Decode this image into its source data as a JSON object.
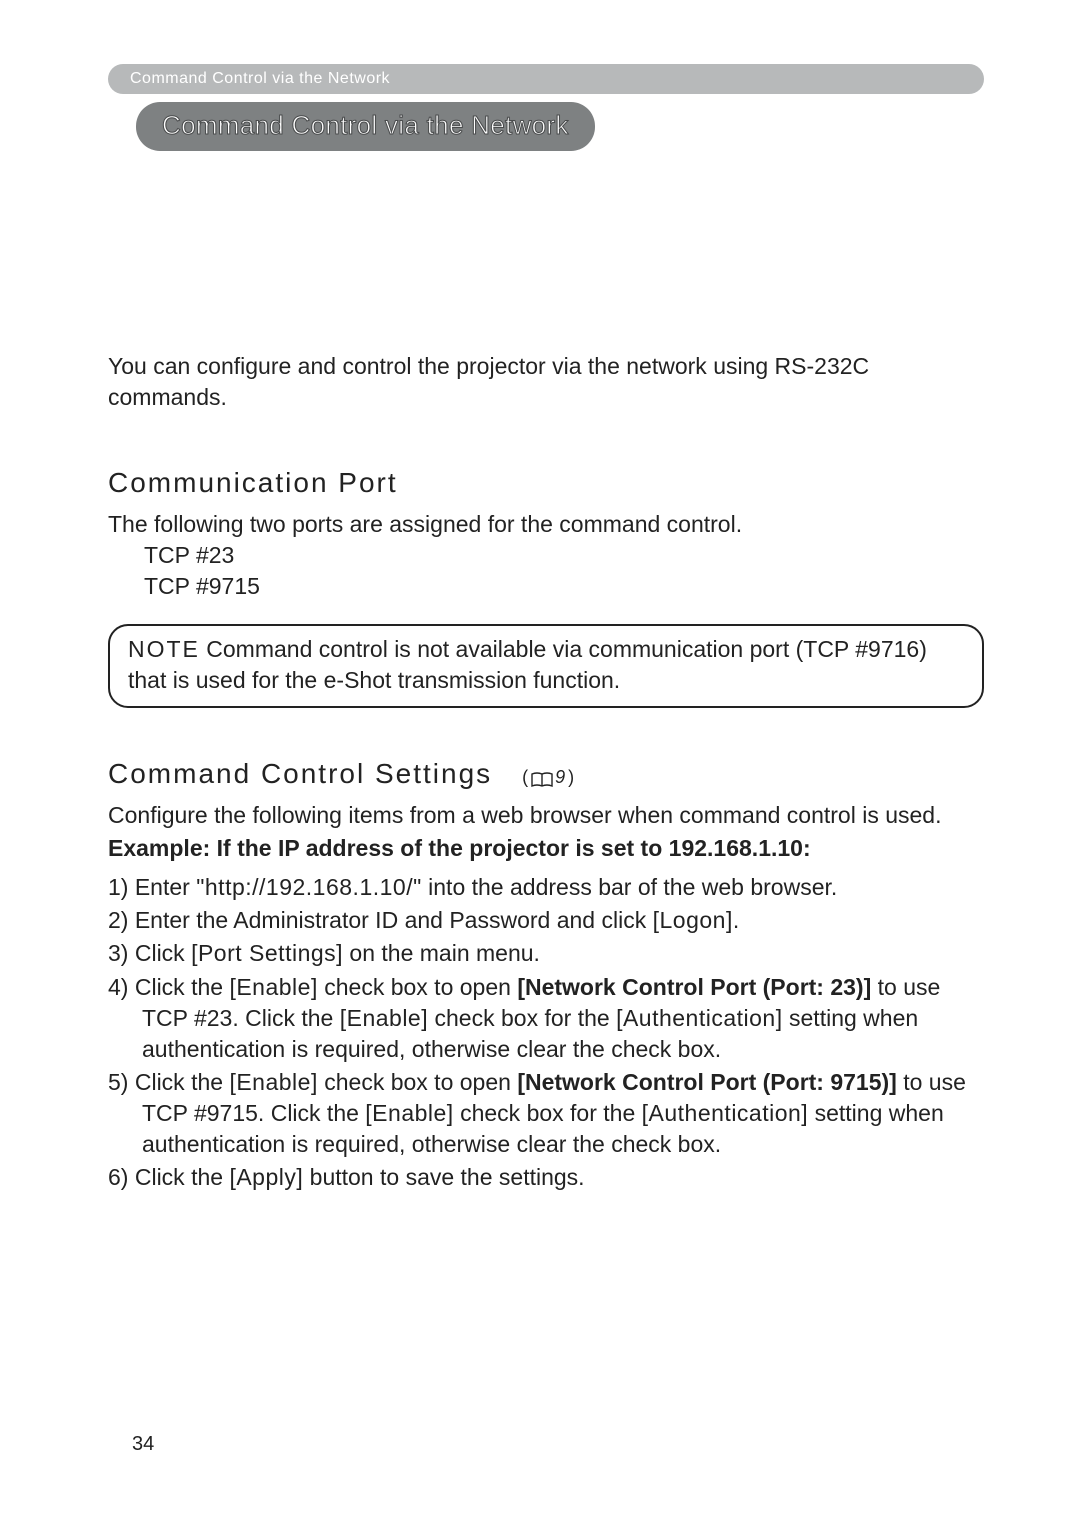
{
  "topbar": "Command Control via the Network",
  "section_title": "Command Control via the Network",
  "intro": "You can configure and control the projector via the network using RS-232C commands.",
  "comm_port": {
    "heading": "Communication Port",
    "lead": "The following two ports are assigned for the command control.",
    "ports": [
      "TCP #23",
      "TCP #9715"
    ]
  },
  "note": {
    "label": "NOTE",
    "text": " Command control is not available via communication port (TCP #9716) that is used for the e-Shot transmission function."
  },
  "settings": {
    "heading": "Command Control Settings",
    "pageref_num": "9",
    "lead": "Configure the following items from a web browser when command control is used.",
    "example_label": "Example: If the IP address of the projector is set to 192.168.1.10:",
    "steps": [
      {
        "n": "1)",
        "pre": "Enter ",
        "mid": "\"http://192.168.1.10/\"",
        "post": " into the address bar of the web browser."
      },
      {
        "n": "2)",
        "pre": "Enter the Administrator ID and Password and click ",
        "mid": "[Logon]",
        "post": "."
      },
      {
        "n": "3)",
        "pre": "Click ",
        "mid": "[Port Settings]",
        "post": " on the main menu."
      },
      {
        "n": "4)",
        "text": "Click the [Enable] check box to open [Network Control Port (Port: 23)] to use TCP #23. Click the [Enable] check box for the [Authentication] setting when authentication is required, otherwise clear the check box.",
        "bold": "[Network Control Port (Port: 23)]"
      },
      {
        "n": "5)",
        "text": "Click the [Enable] check box to open [Network Control Port (Port: 9715)] to use TCP #9715. Click the [Enable] check box for the [Authentication] setting when authentication is required, otherwise clear the check box.",
        "bold": "[Network Control Port (Port: 9715)]"
      },
      {
        "n": "6)",
        "pre": "Click the ",
        "mid": "[Apply]",
        "post": " button to save the settings."
      }
    ]
  },
  "page_number": "34"
}
